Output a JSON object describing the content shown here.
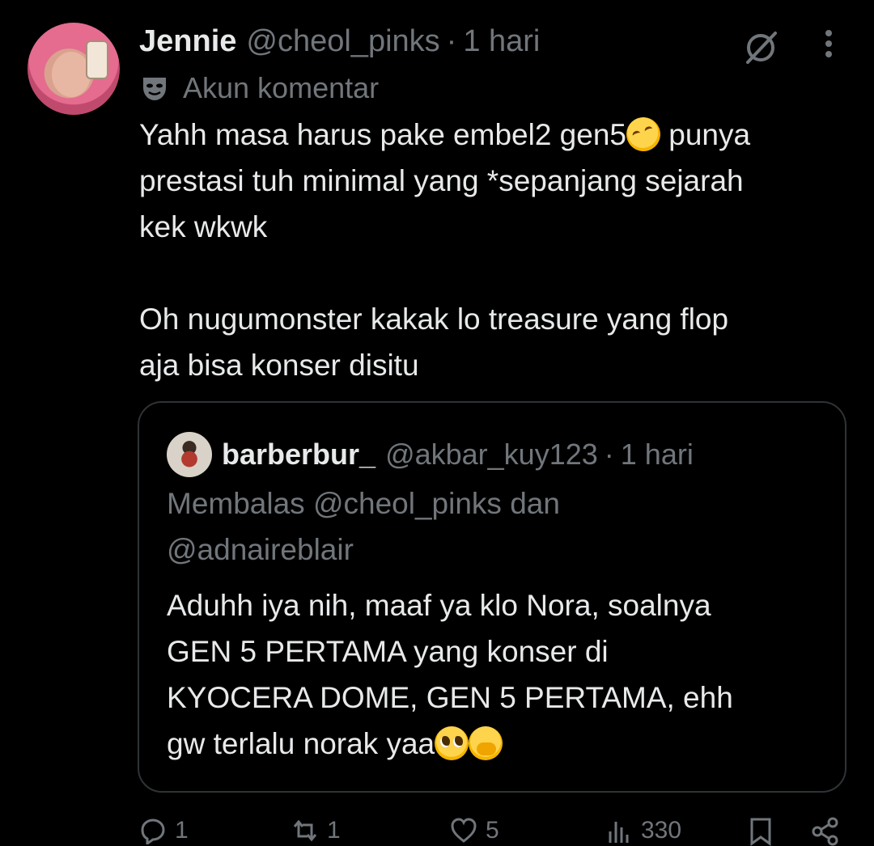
{
  "post": {
    "author_name": "Jennie",
    "author_handle": "@cheol_pinks",
    "separator": "·",
    "time": "1 hari",
    "label": "Akun komentar",
    "text_lines": [
      "Yahh masa harus pake embel2 gen5",
      " punya",
      "prestasi tuh minimal yang *sepanjang sejarah",
      "kek wkwk",
      "Oh nugumonster kakak lo treasure yang flop",
      "aja bisa konser disitu"
    ]
  },
  "quote": {
    "author_name": "barberbur_",
    "author_handle": "@akbar_kuy123",
    "separator": "·",
    "time": "1 hari",
    "reply_line_1": "Membalas @cheol_pinks dan",
    "reply_line_2": "@adnaireblair",
    "body_lines": [
      "Aduhh iya nih, maaf ya klo Nora, soalnya",
      "GEN 5 PERTAMA yang konser di",
      "KYOCERA DOME, GEN 5 PERTAMA, ehh",
      "gw terlalu norak yaa"
    ]
  },
  "actions": {
    "replies": "1",
    "reposts": "1",
    "likes": "5",
    "views": "330"
  },
  "colors": {
    "background": "#000000",
    "text": "#e7e9ea",
    "muted": "#71767b",
    "border": "#2f3336"
  },
  "icons": [
    "grok-icon",
    "more-icon",
    "mask-icon",
    "reply-icon",
    "repost-icon",
    "like-icon",
    "views-icon",
    "bookmark-icon",
    "share-icon"
  ]
}
